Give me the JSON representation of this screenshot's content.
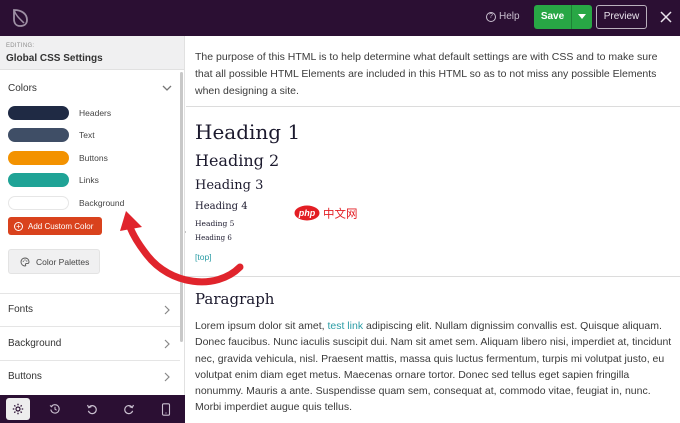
{
  "topbar": {
    "logo_icon": "leaf-icon",
    "help_label": "Help",
    "save_label": "Save",
    "preview_label": "Preview"
  },
  "sidebar": {
    "editing_label": "EDITING:",
    "editing_title": "Global CSS Settings",
    "colors": {
      "heading": "Colors",
      "swatches": [
        {
          "label": "Headers",
          "color": "#1f2a44"
        },
        {
          "label": "Text",
          "color": "#3f4e66"
        },
        {
          "label": "Buttons",
          "color": "#f39200"
        },
        {
          "label": "Links",
          "color": "#1fa396"
        },
        {
          "label": "Background",
          "color": "#ffffff"
        }
      ],
      "add_button": "Add Custom Color",
      "palettes_button": "Color Palettes"
    },
    "sections": [
      "Fonts",
      "Background",
      "Buttons"
    ]
  },
  "content": {
    "intro": "The purpose of this HTML is to help determine what default settings are with CSS and to make sure that all possible HTML Elements are included in this HTML so as to not miss any possible Elements when designing a site.",
    "headings": [
      "Heading 1",
      "Heading 2",
      "Heading 3",
      "Heading 4",
      "Heading 5",
      "Heading 6"
    ],
    "top_link": "[top]",
    "paragraph_title": "Paragraph",
    "para_before": "Lorem ipsum dolor sit amet, ",
    "para_link": "test link",
    "para_after": " adipiscing elit. Nullam dignissim convallis est. Quisque aliquam. Donec faucibus. Nunc iaculis suscipit dui. Nam sit amet sem. Aliquam libero nisi, imperdiet at, tincidunt nec, gravida vehicula, nisl. Praesent mattis, massa quis luctus fermentum, turpis mi volutpat justo, eu volutpat enim diam eget metus. Maecenas ornare tortor. Donec sed tellus eget sapien fringilla nonummy. Mauris a ante. Suspendisse quam sem, consequat at, commodo vitae, feugiat in, nunc. Morbi imperdiet augue quis tellus."
  },
  "watermark": "php 中文网",
  "colors": {
    "topbar": "#2b0f33",
    "save": "#28a745",
    "add_color_button": "#d9421d",
    "link": "#2a9ca5",
    "annotation_arrow": "#e0242c"
  }
}
